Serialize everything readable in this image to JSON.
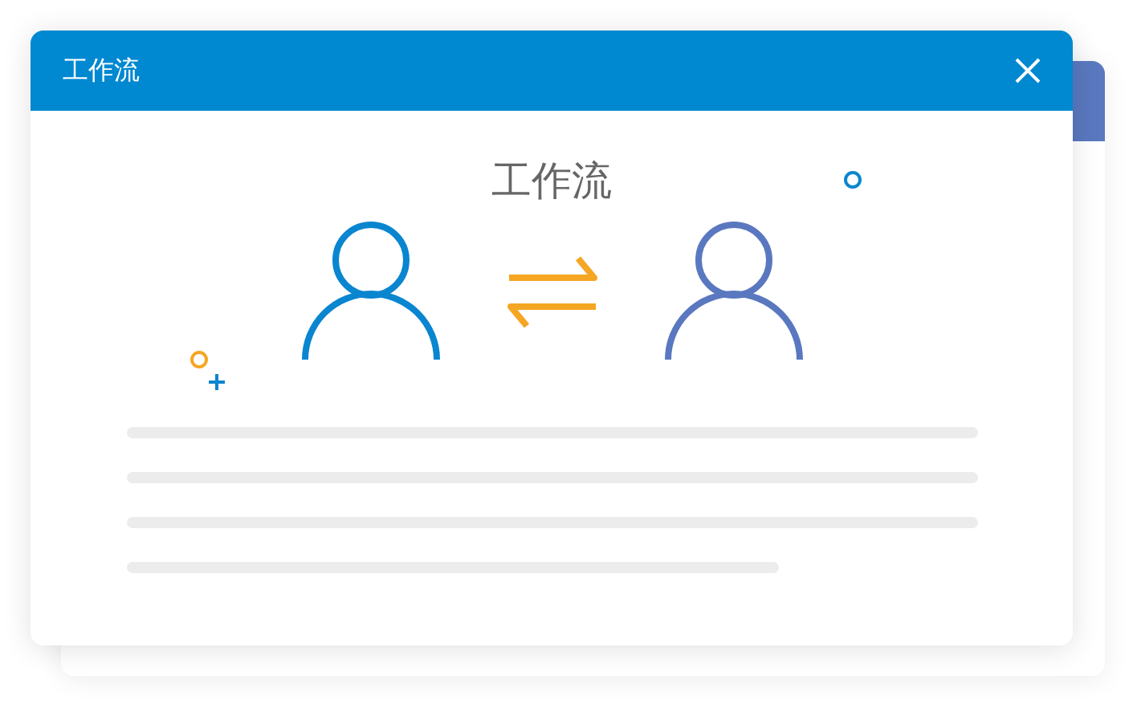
{
  "dialog": {
    "title": "工作流",
    "heading": "工作流"
  }
}
